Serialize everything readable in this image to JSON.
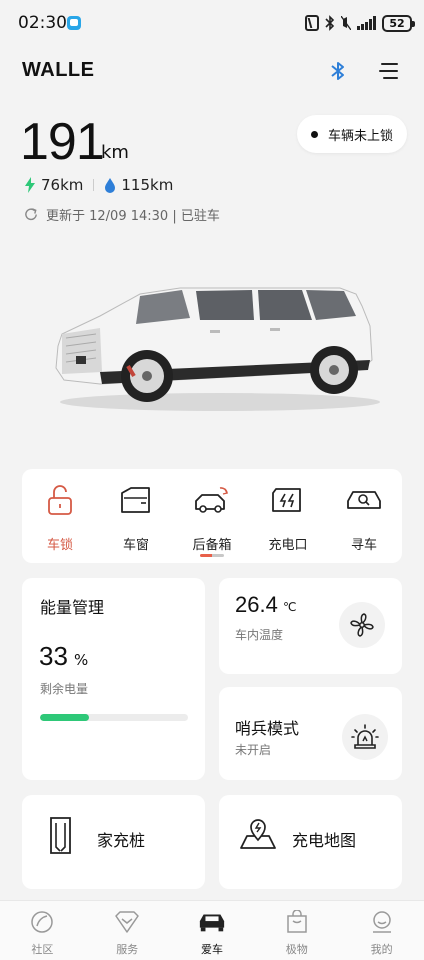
{
  "status_bar": {
    "time": "02:30",
    "battery": "52"
  },
  "header": {
    "brand": "WALLE",
    "icons": [
      "bluetooth-icon",
      "menu-icon"
    ]
  },
  "vehicle": {
    "range_value": "191",
    "range_unit": "km",
    "lock_status": "车辆未上锁",
    "electric_range": "76km",
    "fuel_range": "115km",
    "update_text": "更新于 12/09 14:30 | 已驻车"
  },
  "controls": [
    {
      "label": "车锁",
      "icon": "unlock-icon",
      "active": true
    },
    {
      "label": "车窗",
      "icon": "window-icon",
      "active": false
    },
    {
      "label": "后备箱",
      "icon": "trunk-icon",
      "active": false
    },
    {
      "label": "充电口",
      "icon": "charge-port-icon",
      "active": false
    },
    {
      "label": "寻车",
      "icon": "find-car-icon",
      "active": false
    }
  ],
  "energy": {
    "title": "能量管理",
    "value": "33",
    "unit": "%",
    "label": "剩余电量",
    "level": 0.33
  },
  "climate": {
    "temperature": "26.4",
    "unit": "℃",
    "label": "车内温度"
  },
  "sentry": {
    "title": "哨兵模式",
    "status": "未开启"
  },
  "shortcuts": {
    "home_charger": "家充桩",
    "charge_map": "充电地图"
  },
  "colors": {
    "accent": "#d55a45",
    "energy_bar": "#2ec878",
    "bluetooth": "#2e7fd8"
  },
  "bottom_nav": [
    {
      "label": "社区",
      "icon": "community-icon",
      "active": false
    },
    {
      "label": "服务",
      "icon": "service-icon",
      "active": false
    },
    {
      "label": "爱车",
      "icon": "car-icon",
      "active": true
    },
    {
      "label": "极物",
      "icon": "shop-icon",
      "active": false
    },
    {
      "label": "我的",
      "icon": "profile-icon",
      "active": false
    }
  ]
}
